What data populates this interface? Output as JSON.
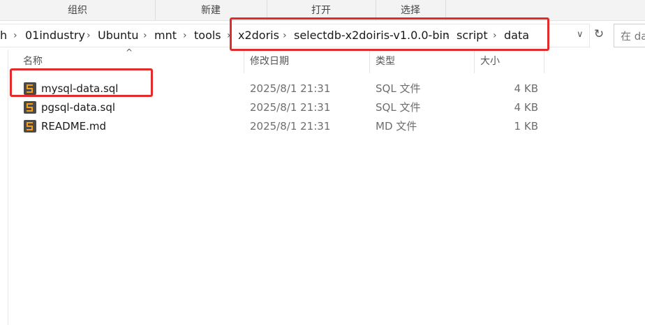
{
  "ribbon": {
    "groups": [
      "组织",
      "新建",
      "打开",
      "选择"
    ]
  },
  "address": {
    "crumbs": [
      "h",
      "01industry",
      "Ubuntu",
      "mnt",
      "tools",
      "x2doris",
      "selectdb-x2doiris-v1.0.0-bin",
      "script",
      "data"
    ],
    "search_placeholder": "在 da"
  },
  "columns": {
    "name": "名称",
    "date": "修改日期",
    "type": "类型",
    "size": "大小"
  },
  "files": [
    {
      "name": "mysql-data.sql",
      "date": "2025/8/1 21:31",
      "type": "SQL 文件",
      "size": "4 KB"
    },
    {
      "name": "pgsql-data.sql",
      "date": "2025/8/1 21:31",
      "type": "SQL 文件",
      "size": "4 KB"
    },
    {
      "name": "README.md",
      "date": "2025/8/1 21:31",
      "type": "MD 文件",
      "size": "1 KB"
    }
  ],
  "annotation_color": "#e32b2b",
  "file_icon": "sublime-text-icon"
}
